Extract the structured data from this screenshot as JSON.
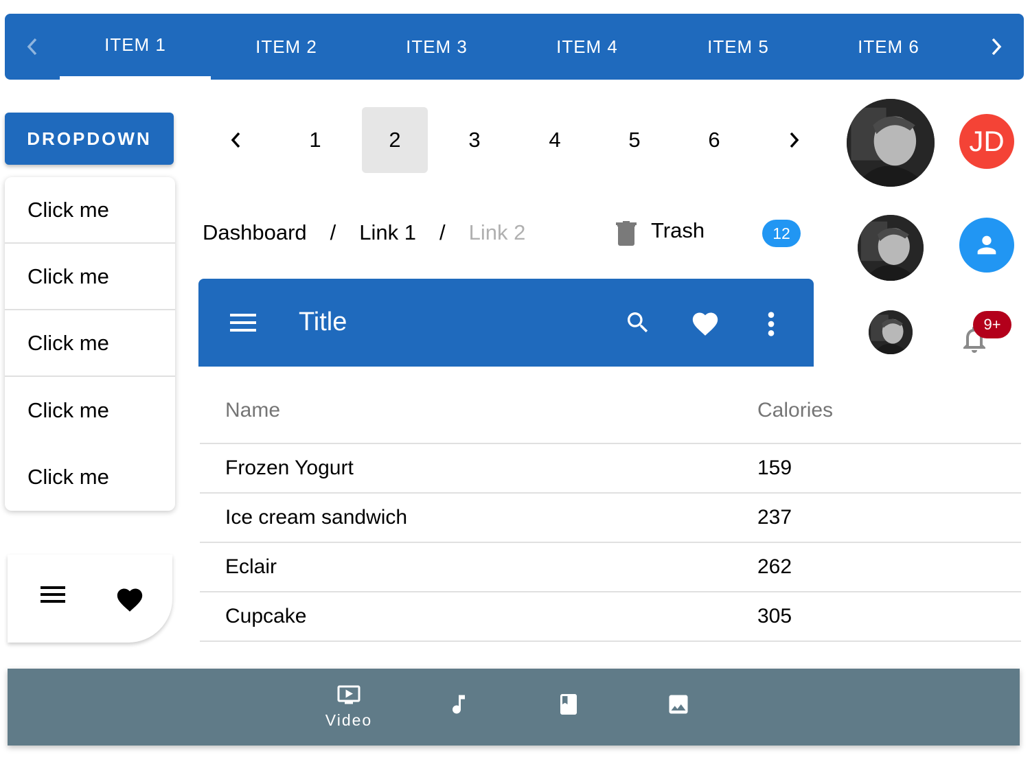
{
  "tabs": {
    "items": [
      {
        "label": "ITEM 1",
        "active": true
      },
      {
        "label": "ITEM 2",
        "active": false
      },
      {
        "label": "ITEM 3",
        "active": false
      },
      {
        "label": "ITEM 4",
        "active": false
      },
      {
        "label": "ITEM 5",
        "active": false
      },
      {
        "label": "ITEM 6",
        "active": false
      }
    ],
    "prev_icon": "chevron-left-icon",
    "next_icon": "chevron-right-icon",
    "color": "#1f6abd"
  },
  "dropdown": {
    "button_label": "DROPDOWN",
    "items": [
      "Click me",
      "Click me",
      "Click me",
      "Click me",
      "Click me"
    ]
  },
  "mini_bar": {
    "icons": [
      "menu-icon",
      "heart-icon"
    ]
  },
  "pagination": {
    "prev_icon": "chevron-left-icon",
    "pages": [
      "1",
      "2",
      "3",
      "4",
      "5",
      "6"
    ],
    "selected": "2",
    "next_icon": "chevron-right-icon"
  },
  "avatars": {
    "initials": "JD",
    "initials_color": "#f44336",
    "person_color": "#2196f3",
    "notification_badge": "9+",
    "notification_badge_color": "#b3001b"
  },
  "breadcrumb": {
    "items": [
      "Dashboard",
      "Link 1",
      "Link 2"
    ],
    "separator": "/"
  },
  "trash_chip": {
    "label": "Trash",
    "count": "12",
    "badge_color": "#2196f3"
  },
  "appbar": {
    "title": "Title",
    "icons": [
      "menu-icon",
      "search-icon",
      "heart-icon",
      "more-vert-icon"
    ]
  },
  "table": {
    "columns": [
      "Name",
      "Calories"
    ],
    "rows": [
      {
        "name": "Frozen Yogurt",
        "calories": "159"
      },
      {
        "name": "Ice cream sandwich",
        "calories": "237"
      },
      {
        "name": "Eclair",
        "calories": "262"
      },
      {
        "name": "Cupcake",
        "calories": "305"
      }
    ]
  },
  "bottom_nav": {
    "items": [
      {
        "icon": "video-icon",
        "label": "Video",
        "active": true
      },
      {
        "icon": "music-note-icon",
        "label": "",
        "active": false
      },
      {
        "icon": "book-icon",
        "label": "",
        "active": false
      },
      {
        "icon": "image-icon",
        "label": "",
        "active": false
      }
    ],
    "color": "#607b88"
  }
}
